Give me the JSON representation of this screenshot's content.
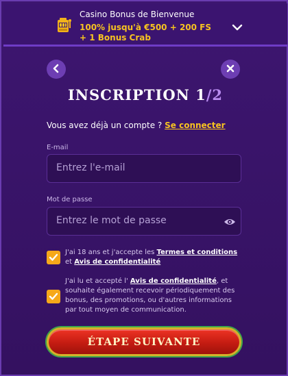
{
  "banner": {
    "title": "Casino Bonus de Bienvenue",
    "subtitle": "100% jusqu'à €500 + 200 FS + 1 Bonus Crab",
    "icon": "slot-machine-icon",
    "chevron": "chevron-down-icon"
  },
  "nav": {
    "back_icon": "chevron-left-icon",
    "close_icon": "close-icon"
  },
  "heading": {
    "title": "INSCRIPTION 1",
    "step": "/2"
  },
  "login": {
    "text": "Vous avez déjà un compte ?",
    "link": "Se connecter"
  },
  "form": {
    "email_label": "E-mail",
    "email_placeholder": "Entrez l'e-mail",
    "password_label": "Mot de passe",
    "password_placeholder": "Entrez le mot de passe"
  },
  "consents": {
    "terms_prefix": "J'ai 18 ans et j'accepte les",
    "terms_link": "Termes et conditions",
    "terms_and": "et",
    "privacy_link": "Avis de confidentialité",
    "marketing_prefix": "J'ai lu et accepté l'",
    "marketing_link": "Avis de confidentialité",
    "marketing_suffix": ", et souhaite également recevoir périodiquement des bonus, des promotions, ou d'autres informations par tout moyen de communication.",
    "terms_checked": true,
    "marketing_checked": true
  },
  "actions": {
    "next_label": "ÉTAPE SUIVANTE"
  },
  "colors": {
    "accent": "#f7c320",
    "background": "#3a1468",
    "checkbox": "#f6a81a",
    "button": "#d42218"
  }
}
